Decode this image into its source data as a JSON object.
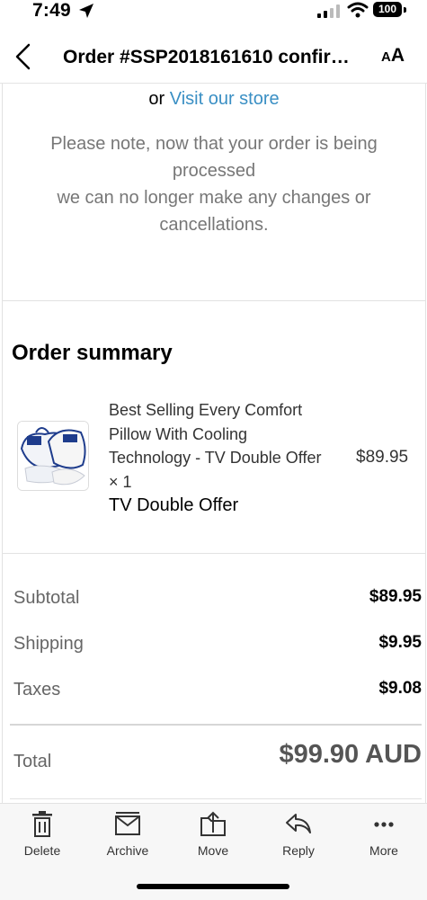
{
  "status_bar": {
    "time": "7:49",
    "battery": "100"
  },
  "nav": {
    "title": "Order #SSP2018161610 confirmed"
  },
  "store_notice": {
    "prefix": "or",
    "link": "Visit our store",
    "note_line1": "Please note, now that your order is being processed",
    "note_line2": "we can no longer make any changes or cancellations."
  },
  "order_summary": {
    "heading": "Order summary",
    "item": {
      "name": "Best Selling Every Comfort Pillow With Cooling Technology - TV Double Offer × 1",
      "variant": "TV Double Offer",
      "price": "$89.95"
    }
  },
  "totals": {
    "rows": [
      {
        "label": "Subtotal",
        "value": "$89.95"
      },
      {
        "label": "Shipping",
        "value": "$9.95"
      },
      {
        "label": "Taxes",
        "value": "$9.08"
      }
    ],
    "total_label": "Total",
    "total_value": "$99.90 AUD"
  },
  "toolbar": {
    "delete": "Delete",
    "archive": "Archive",
    "move": "Move",
    "reply": "Reply",
    "more": "More"
  },
  "icons": {
    "back": "chevron-left-icon",
    "text_size": "text-size-icon",
    "delete": "trash-icon",
    "archive": "archive-box-icon",
    "move": "folder-move-icon",
    "reply": "reply-arrow-icon",
    "more": "ellipsis-icon"
  },
  "colors": {
    "link": "#3a8fc4",
    "toolbar_bg": "#f7f7f7"
  }
}
